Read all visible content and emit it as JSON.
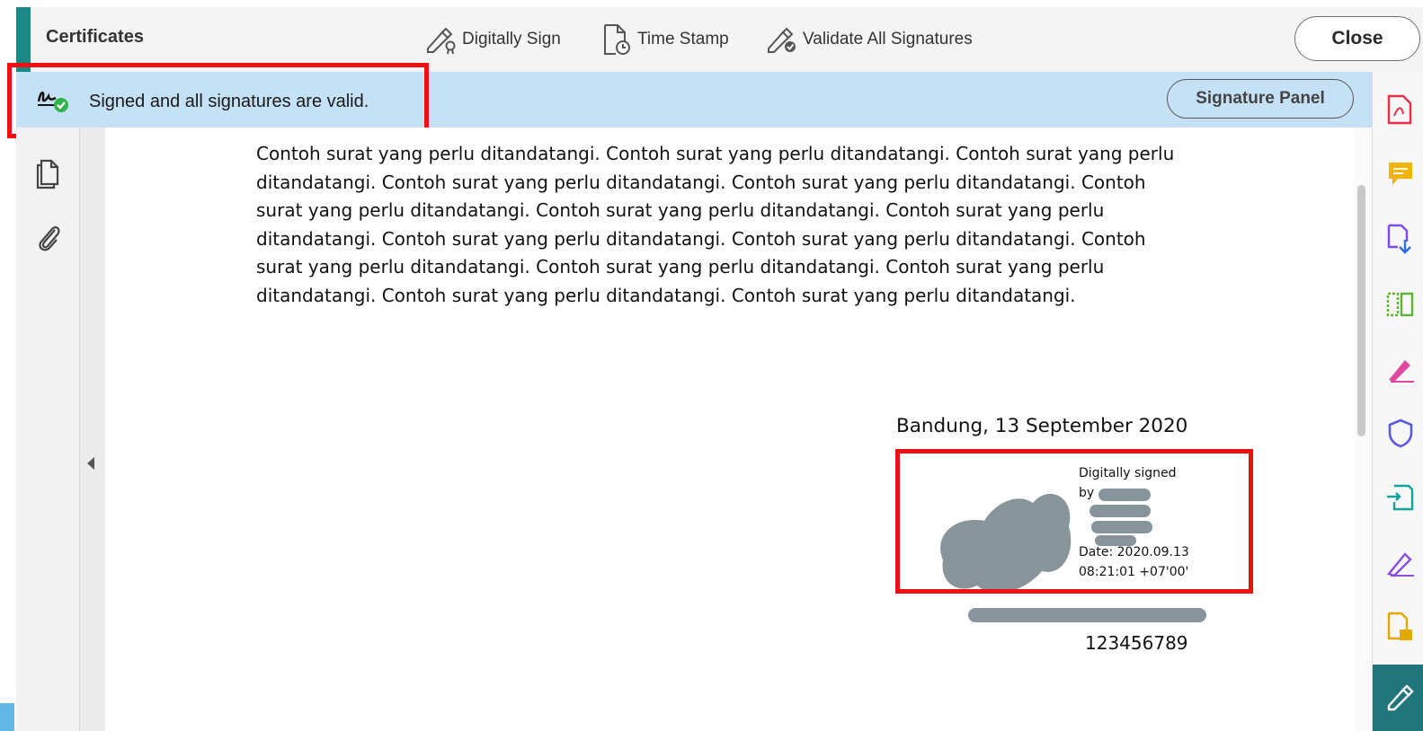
{
  "toolbar": {
    "title": "Certificates",
    "digitally_sign": "Digitally Sign",
    "time_stamp": "Time Stamp",
    "validate_all": "Validate All Signatures",
    "close": "Close"
  },
  "banner": {
    "message": "Signed and all signatures are valid.",
    "signature_panel": "Signature Panel"
  },
  "document": {
    "paragraph": "Contoh surat yang perlu ditandatangi. Contoh surat yang perlu ditandatangi. Contoh surat yang perlu ditandatangi. Contoh surat yang perlu ditandatangi. Contoh surat yang perlu ditandatangi. Contoh surat yang perlu ditandatangi. Contoh surat yang perlu ditandatangi. Contoh surat yang perlu ditandatangi. Contoh surat yang perlu ditandatangi. Contoh surat yang perlu ditandatangi. Contoh surat yang perlu ditandatangi. Contoh surat yang perlu ditandatangi. Contoh surat yang perlu ditandatangi. Contoh surat yang perlu ditandatangi. Contoh surat yang perlu ditandatangi.",
    "place_date": "Bandung, 13 September 2020",
    "signature": {
      "line1": "Digitally signed",
      "line2": "by",
      "date_line": "Date: 2020.09.13",
      "time_line": "08:21:01 +07'00'"
    },
    "id_number": "123456789"
  },
  "colors": {
    "accent_teal": "#1b8a86",
    "banner_blue": "#c5e1f6",
    "highlight_red": "#ee1111",
    "redaction_gray": "#87959a"
  },
  "right_rail_icons": [
    "create-pdf-icon",
    "comment-icon",
    "export-pdf-icon",
    "organize-pages-icon",
    "fill-sign-icon",
    "protect-icon",
    "send-for-review-icon",
    "edit-pdf-icon",
    "scan-icon",
    "certificates-icon"
  ]
}
